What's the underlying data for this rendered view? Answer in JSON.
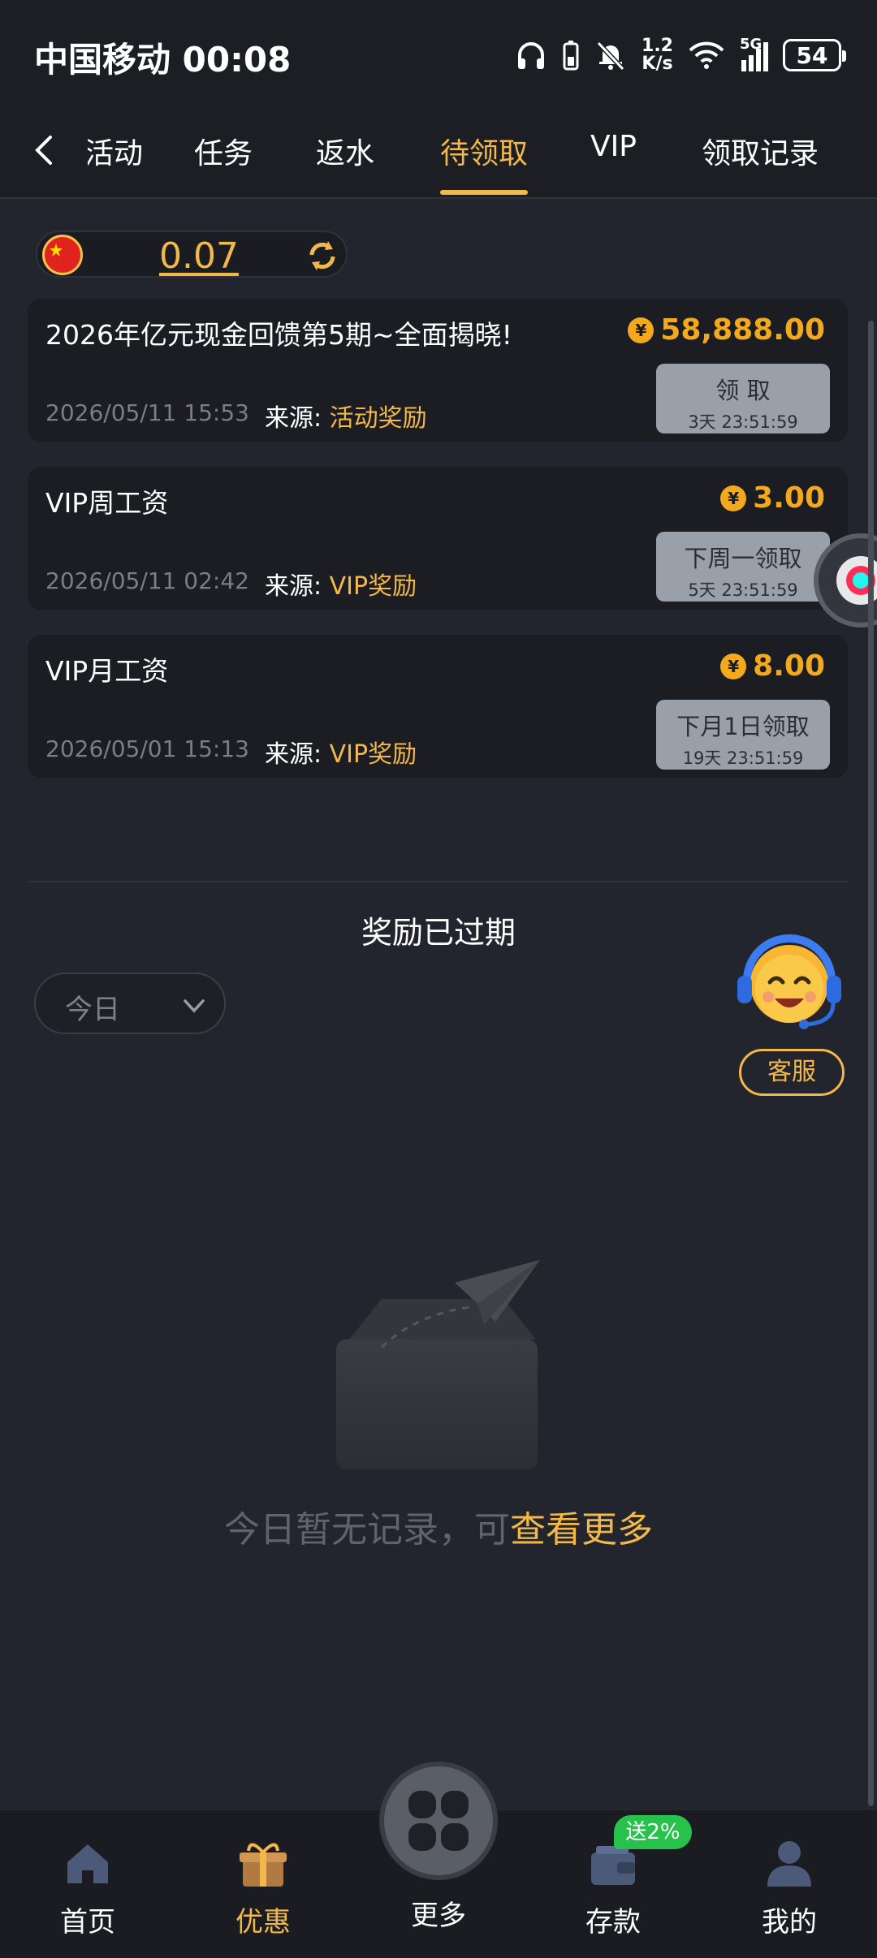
{
  "status_bar": {
    "carrier": "中国移动",
    "time": "00:08",
    "net_speed_value": "1.2",
    "net_speed_unit": "K/s",
    "network": "5G",
    "battery": "54"
  },
  "tabs": [
    {
      "label": "活动",
      "active": false
    },
    {
      "label": "任务",
      "active": false
    },
    {
      "label": "返水",
      "active": false
    },
    {
      "label": "待领取",
      "active": true
    },
    {
      "label": "VIP",
      "active": false
    },
    {
      "label": "领取记录",
      "active": false
    }
  ],
  "balance": {
    "value": "0.07"
  },
  "source_label": "来源:",
  "rewards": [
    {
      "title": "2026年亿元现金回馈第5期~全面揭晓!",
      "amount": "58,888.00",
      "date": "2026/05/11 15:53",
      "source": "活动奖励",
      "button_label": "领 取",
      "countdown": "3天 23:51:59"
    },
    {
      "title": "VIP周工资",
      "amount": "3.00",
      "date": "2026/05/11 02:42",
      "source": "VIP奖励",
      "button_label": "下周一领取",
      "countdown": "5天 23:51:59"
    },
    {
      "title": "VIP月工资",
      "amount": "8.00",
      "date": "2026/05/01 15:13",
      "source": "VIP奖励",
      "button_label": "下月1日领取",
      "countdown": "19天 23:51:59"
    }
  ],
  "expired": {
    "title": "奖励已过期",
    "filter_value": "今日",
    "empty_text": "今日暂无记录，可",
    "empty_link": "查看更多"
  },
  "customer_service": {
    "label": "客服"
  },
  "bottom_nav": {
    "home": "首页",
    "promo": "优惠",
    "more": "更多",
    "deposit": "存款",
    "deposit_badge": "送2%",
    "mine": "我的"
  },
  "colors": {
    "accent": "#f2b84a",
    "amount": "#f2a91e",
    "background": "#22252d",
    "card": "#1b1d23",
    "badge_green": "#27c24c"
  }
}
